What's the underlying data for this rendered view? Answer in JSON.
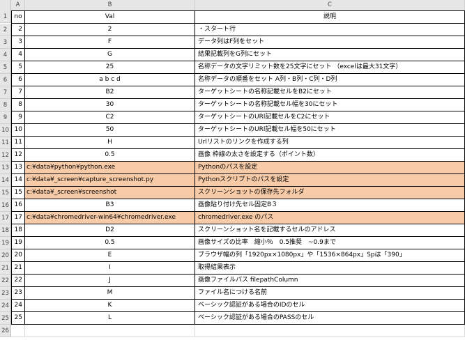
{
  "columns": [
    "A",
    "B",
    "C"
  ],
  "header": {
    "no": "no",
    "val": "Val",
    "desc": "説明"
  },
  "rows": [
    {
      "rn": "2",
      "no": "2",
      "val": "2",
      "desc": "・スタート行",
      "hl": false
    },
    {
      "rn": "3",
      "no": "3",
      "val": "F",
      "desc": "データ列はF列をセット",
      "hl": false
    },
    {
      "rn": "4",
      "no": "4",
      "val": "G",
      "desc": "結果記載列をG列にセット",
      "hl": false
    },
    {
      "rn": "5",
      "no": "5",
      "val": "25",
      "desc": "名称データの文字リミット数を25文字にセット （excelは最大31文字）",
      "hl": false
    },
    {
      "rn": "6",
      "no": "6",
      "val": "a b c d",
      "desc": "名称データの順番をセット A列・B列・C列・D列",
      "hl": false
    },
    {
      "rn": "7",
      "no": "7",
      "val": "B2",
      "desc": "ターゲットシートの名称記載セルをB2にセット",
      "hl": false
    },
    {
      "rn": "8",
      "no": "8",
      "val": "30",
      "desc": "ターゲットシートの名称記載セル幅を30にセット",
      "hl": false
    },
    {
      "rn": "9",
      "no": "9",
      "val": "C2",
      "desc": "ターゲットシートのURl記載セルをC2にセット",
      "hl": false
    },
    {
      "rn": "10",
      "no": "10",
      "val": "50",
      "desc": "ターゲットシートのURl記載セル幅を50にセット",
      "hl": false
    },
    {
      "rn": "11",
      "no": "11",
      "val": "H",
      "desc": "Urlリストのリンクを作成する列",
      "hl": false
    },
    {
      "rn": "12",
      "no": "12",
      "val": "0.5",
      "desc": "画像 枠線の太さを設定する（ポイント数）",
      "hl": false
    },
    {
      "rn": "13",
      "no": "13",
      "val": "c:¥data¥python¥python.exe",
      "desc": "Pythonのパスを設定",
      "hl": true
    },
    {
      "rn": "14",
      "no": "14",
      "val": "c:¥data¥_screen¥capture_screenshot.py",
      "desc": "Pythonスクリプトのパスを設定",
      "hl": true
    },
    {
      "rn": "15",
      "no": "15",
      "val": "c:¥data¥_screen¥screenshot",
      "desc": "スクリーンショットの保存先フォルダ",
      "hl": true
    },
    {
      "rn": "16",
      "no": "16",
      "val": "B3",
      "desc": "画像貼り付け先セル固定B３",
      "hl": false
    },
    {
      "rn": "17",
      "no": "17",
      "val": "c:¥data¥chromedriver-win64¥chromedriver.exe",
      "desc": "chromedriver.exe のパス",
      "hl": true
    },
    {
      "rn": "18",
      "no": "18",
      "val": "D2",
      "desc": "スクリーンショット名を記載するセルのアドレス",
      "hl": false
    },
    {
      "rn": "19",
      "no": "19",
      "val": "0.5",
      "desc": "画像サイズの比率　縮小％　0.5推奨　~0.9まで",
      "hl": false
    },
    {
      "rn": "20",
      "no": "20",
      "val": "E",
      "desc": "ブラウザ幅の列「1920px×1080px」や「1536×864px」Spは「390」",
      "hl": false
    },
    {
      "rn": "21",
      "no": "21",
      "val": "I",
      "desc": "取得結果表示",
      "hl": false
    },
    {
      "rn": "22",
      "no": "22",
      "val": "J",
      "desc": "画像ファイルパス filepathColumn",
      "hl": false
    },
    {
      "rn": "23",
      "no": "23",
      "val": "M",
      "desc": "ファイル名につける名前",
      "hl": false
    },
    {
      "rn": "24",
      "no": "24",
      "val": "K",
      "desc": "ベーシック認証がある場合のIDのセル",
      "hl": false
    },
    {
      "rn": "25",
      "no": "25",
      "val": "L",
      "desc": "ベーシック認証がある場合のPASSのセル",
      "hl": false
    }
  ],
  "highlight_color": "#f8cba8"
}
